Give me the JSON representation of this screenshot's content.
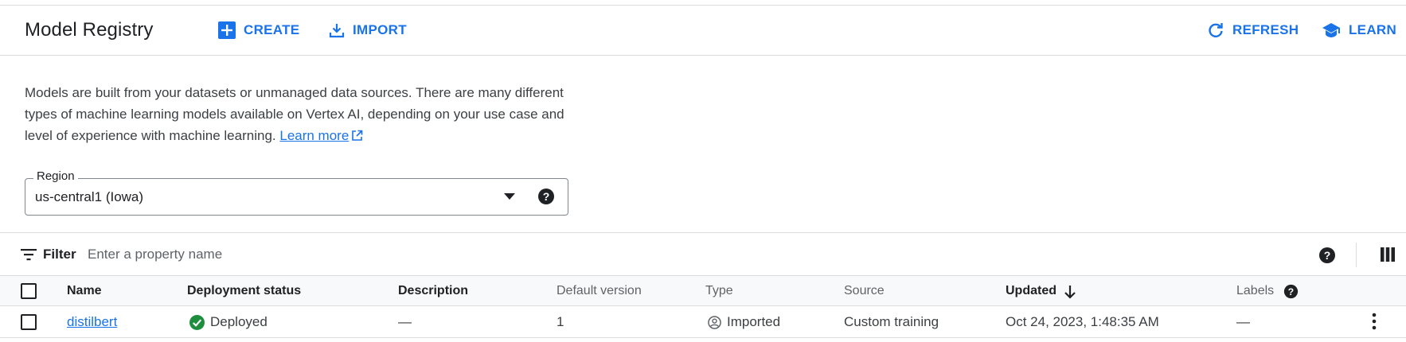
{
  "header": {
    "title": "Model Registry",
    "create_label": "CREATE",
    "import_label": "IMPORT",
    "refresh_label": "REFRESH",
    "learn_label": "LEARN",
    "accent_color": "#1a73e8"
  },
  "intro": {
    "text": "Models are built from your datasets or unmanaged data sources. There are many different types of machine learning models available on Vertex AI, depending on your use case and level of experience with machine learning.",
    "link_label": "Learn more"
  },
  "region": {
    "label": "Region",
    "value": "us-central1 (Iowa)"
  },
  "filter": {
    "label": "Filter",
    "placeholder": "Enter a property name"
  },
  "table": {
    "columns": {
      "name": "Name",
      "deployment_status": "Deployment status",
      "description": "Description",
      "default_version": "Default version",
      "type": "Type",
      "source": "Source",
      "updated": "Updated",
      "labels": "Labels"
    },
    "sort_column": "Updated",
    "sort_direction": "descending",
    "rows": [
      {
        "name": "distilbert",
        "deployment_status": "Deployed",
        "description": "—",
        "default_version": "1",
        "type": "Imported",
        "source": "Custom training",
        "updated": "Oct 24, 2023, 1:48:35 AM",
        "labels": "—"
      }
    ]
  },
  "icons": {
    "create": "add-box-icon",
    "import": "download-icon",
    "refresh": "refresh-icon",
    "learn": "school-icon",
    "external_link": "open-in-new-icon",
    "dropdown": "arrow-drop-down-icon",
    "help": "help-icon",
    "filter": "filter-list-icon",
    "columns": "view-column-icon",
    "sort": "arrow-downward-icon",
    "deployed": "check-circle-icon",
    "imported": "account-circle-icon",
    "more": "more-vert-icon"
  },
  "status_colors": {
    "deployed": "#1e8e3e"
  }
}
